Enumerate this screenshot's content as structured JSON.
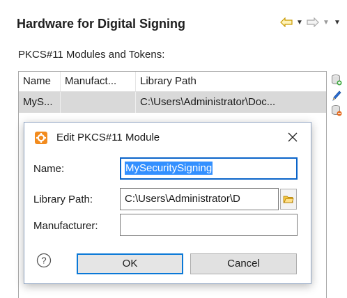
{
  "header": {
    "title": "Hardware for Digital Signing"
  },
  "section": {
    "label": "PKCS#11 Modules and Tokens:"
  },
  "table": {
    "columns": [
      "Name",
      "Manufact...",
      "Library Path"
    ],
    "rows": [
      {
        "name": "MyS...",
        "manufacturer": "",
        "library_path": "C:\\Users\\Administrator\\Doc..."
      }
    ]
  },
  "dialog": {
    "title": "Edit PKCS#11 Module",
    "fields": {
      "name_label": "Name:",
      "name_value": "MySecuritySigning",
      "library_label": "Library Path:",
      "library_value": "C:\\Users\\Administrator\\D",
      "manufacturer_label": "Manufacturer:",
      "manufacturer_value": ""
    },
    "buttons": {
      "ok": "OK",
      "cancel": "Cancel"
    }
  },
  "icons": {
    "back": "arrow-left-icon",
    "forward": "arrow-right-icon",
    "add": "add-module-icon",
    "edit": "pencil-icon",
    "remove": "remove-module-icon",
    "dialog": "orange-settings-icon",
    "close": "close-icon",
    "browse": "folder-icon",
    "help": "help-icon"
  },
  "colors": {
    "accent": "#0a64c9",
    "selection": "#3390ff",
    "icon_orange": "#f28b1e"
  }
}
